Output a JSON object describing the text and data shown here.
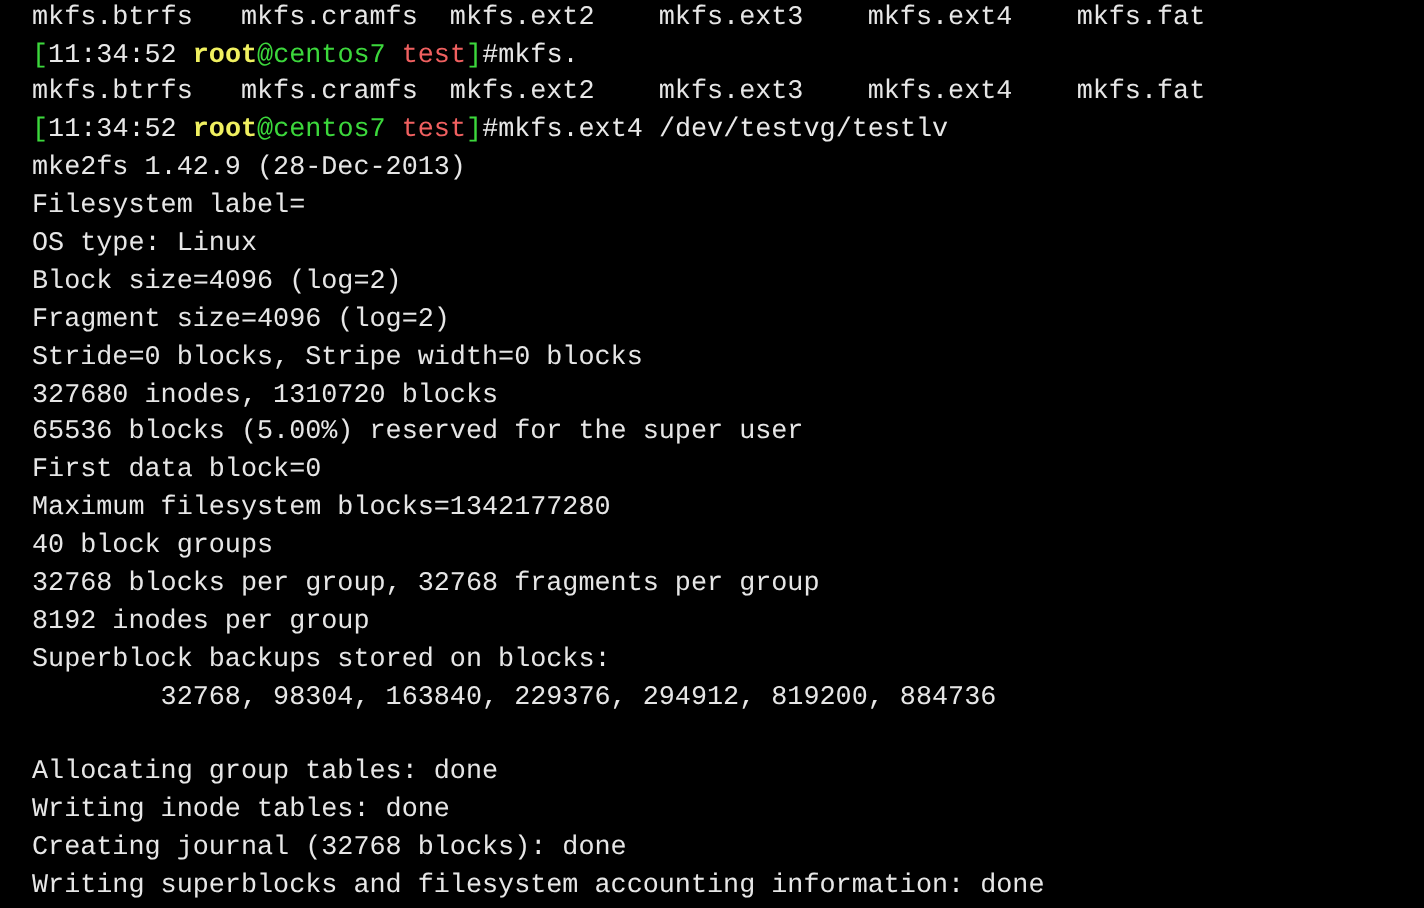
{
  "terminal": {
    "lines": [
      {
        "kind": "output",
        "text": "mkfs.btrfs   mkfs.cramfs  mkfs.ext2    mkfs.ext3    mkfs.ext4    mkfs.fat"
      },
      {
        "kind": "prompt",
        "segments": [
          {
            "text": "[",
            "color": "#3cd83c"
          },
          {
            "text": "11:34:52 ",
            "color": "#e8e8e8"
          },
          {
            "text": "root",
            "color": "#f0f060"
          },
          {
            "text": "@centos7 ",
            "color": "#3cd83c"
          },
          {
            "text": "test",
            "color": "#f06060"
          },
          {
            "text": "]",
            "color": "#3cd83c"
          },
          {
            "text": "#mkfs.",
            "color": "#e8e8e8"
          }
        ]
      },
      {
        "kind": "output",
        "text": "mkfs.btrfs   mkfs.cramfs  mkfs.ext2    mkfs.ext3    mkfs.ext4    mkfs.fat"
      },
      {
        "kind": "prompt",
        "segments": [
          {
            "text": "[",
            "color": "#3cd83c"
          },
          {
            "text": "11:34:52 ",
            "color": "#e8e8e8"
          },
          {
            "text": "root",
            "color": "#f0f060"
          },
          {
            "text": "@centos7 ",
            "color": "#3cd83c"
          },
          {
            "text": "test",
            "color": "#f06060"
          },
          {
            "text": "]",
            "color": "#3cd83c"
          },
          {
            "text": "#mkfs.ext4 /dev/testvg/testlv",
            "color": "#e8e8e8"
          }
        ]
      },
      {
        "kind": "output",
        "text": "mke2fs 1.42.9 (28-Dec-2013)"
      },
      {
        "kind": "output",
        "text": "Filesystem label="
      },
      {
        "kind": "output",
        "text": "OS type: Linux"
      },
      {
        "kind": "output",
        "text": "Block size=4096 (log=2)"
      },
      {
        "kind": "output",
        "text": "Fragment size=4096 (log=2)"
      },
      {
        "kind": "output",
        "text": "Stride=0 blocks, Stripe width=0 blocks"
      },
      {
        "kind": "output",
        "text": "327680 inodes, 1310720 blocks"
      },
      {
        "kind": "output",
        "text": "65536 blocks (5.00%) reserved for the super user"
      },
      {
        "kind": "output",
        "text": "First data block=0"
      },
      {
        "kind": "output",
        "text": "Maximum filesystem blocks=1342177280"
      },
      {
        "kind": "output",
        "text": "40 block groups"
      },
      {
        "kind": "output",
        "text": "32768 blocks per group, 32768 fragments per group"
      },
      {
        "kind": "output",
        "text": "8192 inodes per group"
      },
      {
        "kind": "output",
        "text": "Superblock backups stored on blocks:"
      },
      {
        "kind": "output",
        "text": "        32768, 98304, 163840, 229376, 294912, 819200, 884736"
      },
      {
        "kind": "blank"
      },
      {
        "kind": "output",
        "text": "Allocating group tables: done"
      },
      {
        "kind": "output",
        "text": "Writing inode tables: done"
      },
      {
        "kind": "output",
        "text": "Creating journal (32768 blocks): done"
      },
      {
        "kind": "output",
        "text": "Writing superblocks and filesystem accounting information: done"
      }
    ]
  }
}
